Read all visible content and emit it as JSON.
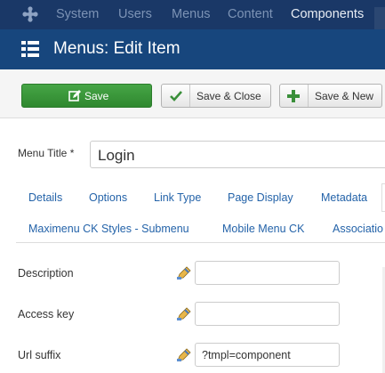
{
  "topnav": {
    "items": [
      "System",
      "Users",
      "Menus",
      "Content",
      "Components"
    ]
  },
  "header": {
    "title": "Menus: Edit Item",
    "icon": "list-icon"
  },
  "toolbar": {
    "save_label": "Save",
    "save_close_label": "Save & Close",
    "save_new_label": "Save & New"
  },
  "menu_title": {
    "label": "Menu Title *",
    "value": "Login"
  },
  "tabs": {
    "row1": [
      "Details",
      "Options",
      "Link Type",
      "Page Display",
      "Metadata"
    ],
    "row2": [
      "Maximenu CK Styles - Submenu",
      "Mobile Menu CK",
      "Associatio"
    ]
  },
  "fields": [
    {
      "label": "Description",
      "value": ""
    },
    {
      "label": "Access key",
      "value": ""
    },
    {
      "label": "Url suffix",
      "value": "?tmpl=component"
    }
  ],
  "colors": {
    "topbar": "#1a3867",
    "header": "#17467d",
    "save_green": "#3d9b3d",
    "link_blue": "#2463a9"
  }
}
